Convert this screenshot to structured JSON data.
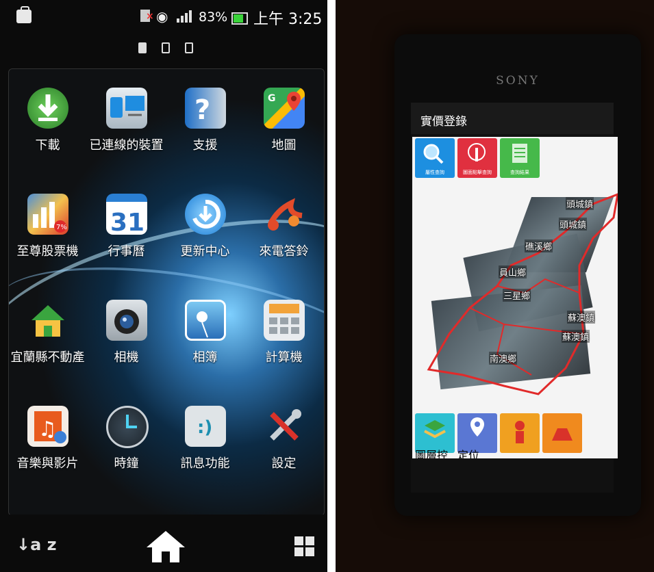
{
  "status_bar": {
    "battery_percent": "83%",
    "time": "上午 3:25",
    "icons": [
      "shopping-bag-icon",
      "sim-error-icon",
      "wifi-icon",
      "signal-icon",
      "battery-icon"
    ]
  },
  "pager": {
    "pages": 3,
    "active": 1
  },
  "apps": [
    {
      "label": "下載",
      "icon": "download-icon",
      "color": "#4bb34b"
    },
    {
      "label": "已連線的裝置",
      "icon": "connected-devices-icon",
      "color": "#2a8ed8"
    },
    {
      "label": "支援",
      "icon": "support-icon",
      "color": "#2f7ad1"
    },
    {
      "label": "地圖",
      "icon": "maps-icon",
      "color": "#34a853"
    },
    {
      "label": "至尊股票機",
      "icon": "stock-icon",
      "color": "#d6a123"
    },
    {
      "label": "行事曆",
      "icon": "calendar-icon",
      "color": "#2a7fd3"
    },
    {
      "label": "更新中心",
      "icon": "update-center-icon",
      "color": "#2fa4ef"
    },
    {
      "label": "來電答鈴",
      "icon": "ringtone-icon",
      "color": "#e24b2a"
    },
    {
      "label": "宜蘭縣不動產",
      "icon": "house-icon",
      "color": "#3aa53f"
    },
    {
      "label": "相機",
      "icon": "camera-icon",
      "color": "#4a4a4a"
    },
    {
      "label": "相簿",
      "icon": "album-icon",
      "color": "#2d7fcf"
    },
    {
      "label": "計算機",
      "icon": "calculator-icon",
      "color": "#e9a034"
    },
    {
      "label": "音樂與影片",
      "icon": "music-video-icon",
      "color": "#e85b1e"
    },
    {
      "label": "時鐘",
      "icon": "clock-icon",
      "color": "#3b4a57"
    },
    {
      "label": "訊息功能",
      "icon": "messaging-icon",
      "color": "#dfe4e7"
    },
    {
      "label": "設定",
      "icon": "settings-icon",
      "color": "#c9d0d6"
    }
  ],
  "dock": {
    "sort_label": "↓a z",
    "home_icon": "home-icon",
    "grid_icon": "app-grid-icon"
  },
  "photo": {
    "brand": "SONY",
    "app_title": "實價登錄",
    "top_buttons": [
      {
        "label": "屬性查詢",
        "icon": "search-icon",
        "color": "#1d8fe0"
      },
      {
        "label": "圖面點擊查詢",
        "icon": "tap-icon",
        "color": "#e0303f"
      },
      {
        "label": "查詢結果",
        "icon": "list-icon",
        "color": "#46b94a"
      }
    ],
    "towns": [
      "頭城鎮",
      "頭城鎮",
      "礁溪鄉",
      "員山鄉",
      "三星鄉",
      "蘇澳鎮",
      "蘇澳鎮",
      "南澳鄉"
    ],
    "bottom_buttons": [
      {
        "label": "圖層控制",
        "icon": "layers-icon",
        "color": "#2dbfd1"
      },
      {
        "label": "定位",
        "icon": "location-icon",
        "color": "#5a77d3"
      },
      {
        "label": "",
        "icon": "person-icon",
        "color": "#f0a020"
      },
      {
        "label": "",
        "icon": "building-icon",
        "color": "#f08a1e"
      }
    ]
  }
}
